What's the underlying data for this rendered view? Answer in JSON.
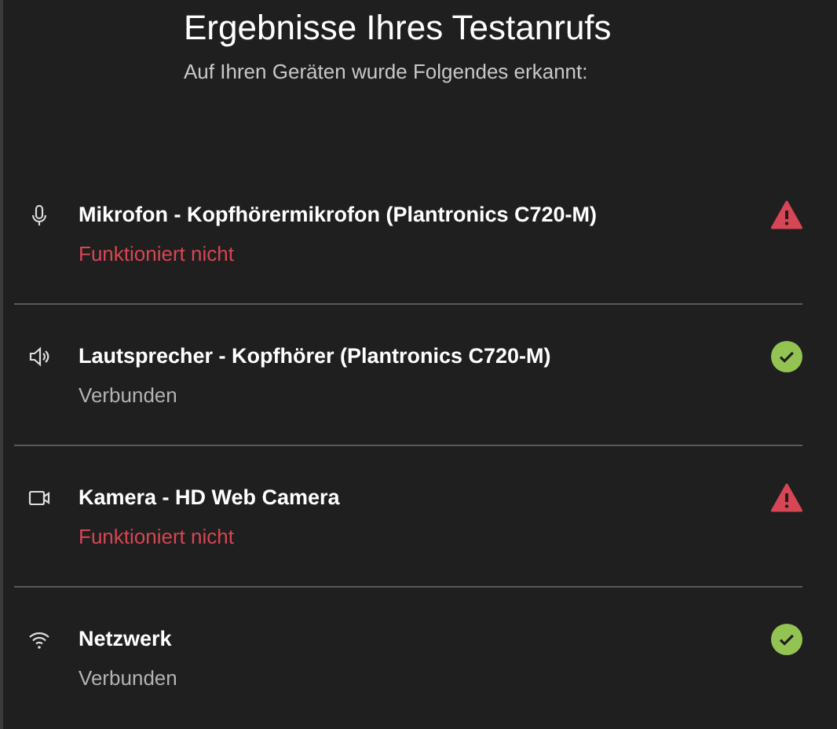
{
  "title": "Ergebnisse Ihres Testanrufs",
  "subtitle": "Auf Ihren Geräten wurde Folgendes erkannt:",
  "devices": [
    {
      "kind": "microphone",
      "name": "Mikrofon - Kopfhörermikrofon (Plantronics C720-M)",
      "status": "Funktioniert nicht",
      "ok": false
    },
    {
      "kind": "speaker",
      "name": "Lautsprecher - Kopfhörer (Plantronics C720-M)",
      "status": "Verbunden",
      "ok": true
    },
    {
      "kind": "camera",
      "name": "Kamera - HD Web Camera",
      "status": "Funktioniert nicht",
      "ok": false
    },
    {
      "kind": "network",
      "name": "Netzwerk",
      "status": "Verbunden",
      "ok": true
    }
  ]
}
